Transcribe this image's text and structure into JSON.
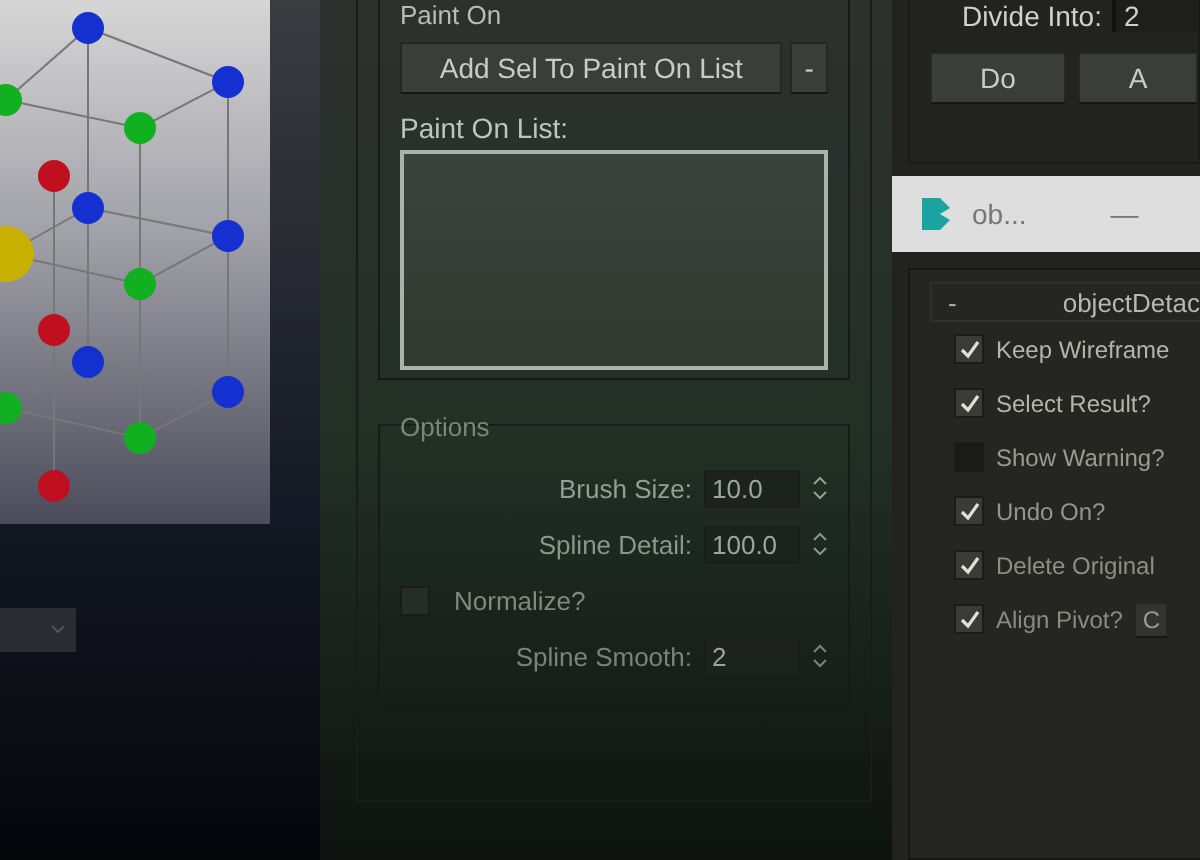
{
  "paint_on": {
    "title": "Paint On",
    "add_button": "Add Sel To Paint On List",
    "remove_button": "-",
    "list_label": "Paint On List:"
  },
  "options": {
    "title": "Options",
    "rows": [
      {
        "kind": "spinner",
        "label": "Brush Size:",
        "value": "10.0"
      },
      {
        "kind": "spinner",
        "label": "Spline Detail:",
        "value": "100.0"
      },
      {
        "kind": "checkbox",
        "label": "Normalize?",
        "checked": false
      },
      {
        "kind": "spinner",
        "label": "Spline Smooth:",
        "value": "2"
      }
    ]
  },
  "divide": {
    "label": "Divide Into:",
    "value": "2",
    "buttons": [
      "Do",
      "A"
    ]
  },
  "tool_window": {
    "title": "ob...",
    "minimize": "—",
    "rollout_toggle": "-",
    "rollout_title": "objectDetac",
    "checks": [
      {
        "label": "Keep Wireframe",
        "checked": true
      },
      {
        "label": "Select Result?",
        "checked": true
      },
      {
        "label": "Show Warning?",
        "checked": false
      },
      {
        "label": "Undo On?",
        "checked": true
      },
      {
        "label": "Delete Original",
        "checked": true
      },
      {
        "label": "Align Pivot?",
        "checked": true,
        "button": "C"
      }
    ]
  }
}
